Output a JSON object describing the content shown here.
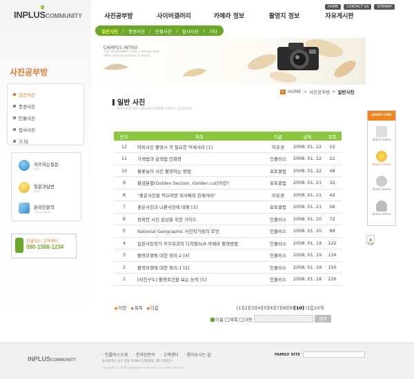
{
  "header": {
    "logo_main": "INPLUS",
    "logo_sub": "COMMUNITY",
    "top_links": [
      "HOME",
      "CONTACT US",
      "SITEMAP"
    ],
    "gnb": [
      "사진공부방",
      "사이버갤러리",
      "카메라 정보",
      "촬영지 정보",
      "자유게시판"
    ],
    "sub_menu": [
      "일반사진",
      "풍경사진",
      "인물사진",
      "접사사진",
      "기타"
    ]
  },
  "banner": {
    "title": "CAMPUS INTRO",
    "copy": "THE DESIGNING IS No.1 design web total solution partner in Korea"
  },
  "sidebar": {
    "title": "사진공부방",
    "menu": [
      "일반사진",
      "풍경사진",
      "인물사진",
      "접사사진",
      "기    타"
    ],
    "links": [
      {
        "label": "자주하는질문",
        "sub": "FAQ"
      },
      {
        "label": "질문과답변",
        "sub": "Q&A"
      },
      {
        "label": "온라인문의",
        "sub": "online guide"
      }
    ],
    "call_label": "인플러스 고객센터",
    "call_number": "080-1588-1234"
  },
  "content": {
    "title": "일반 사진",
    "description": "일반사진에 대한 이해/사용기/강좌를 가져하는 공간입니다.",
    "breadcrumb": [
      "HOME",
      "사진공부방",
      "일반사진"
    ]
  },
  "board": {
    "headers": [
      "번호",
      "제목",
      "이름",
      "날짜",
      "조회"
    ],
    "rows": [
      {
        "no": "12",
        "title": "야외사진 촬영시 꼭 필요한 악세사리 [1]",
        "name": "이유경",
        "date": "2008. 01. 22",
        "views": "15"
      },
      {
        "no": "11",
        "title": "가색법과 감색법 인화용",
        "name": "인플러스",
        "date": "2008. 01. 22",
        "views": "22"
      },
      {
        "no": "10",
        "title": "불꽃놀이 사진 촬영하는 방법",
        "name": "포토클럽",
        "date": "2008. 01. 22",
        "views": "48"
      },
      {
        "no": "9",
        "title": "황금분할(Golden Section, Golden cut)이란?",
        "name": "포토클럽",
        "date": "2008. 01. 21",
        "views": "32"
      },
      {
        "no": "8",
        "title": "\"좋은사진을 찍으려면 피사체와 친해져라\"",
        "name": "이유경",
        "date": "2008. 01. 21",
        "views": "42"
      },
      {
        "no": "7",
        "title": "좋은사진과 나쁜사진에 대해 [3]",
        "name": "포토클럽",
        "date": "2008. 01. 21",
        "views": "56"
      },
      {
        "no": "6",
        "title": "정확한 사진 감상을 위한 가이드",
        "name": "인플러스",
        "date": "2008. 01. 20",
        "views": "72"
      },
      {
        "no": "5",
        "title": "National Geographic 사진작가들의 조언",
        "name": "인플러스",
        "date": "2008. 01. 20",
        "views": "88"
      },
      {
        "no": "4",
        "title": "일본사진작가 후쿠쉬코의 디지털SLR 카메라 촬영방법",
        "name": "인플러스",
        "date": "2008. 01. 19",
        "views": "122"
      },
      {
        "no": "3",
        "title": "촬영모랫에 대한 정리-2 [4]",
        "name": "인플러스",
        "date": "2008. 01. 19",
        "views": "134"
      },
      {
        "no": "2",
        "title": "촬영모랫에 대한 정리-1 [2]",
        "name": "인플러스",
        "date": "2008. 01. 19",
        "views": "150"
      },
      {
        "no": "1",
        "title": "[사진구도] 촬영조건을 보는 능력 [5]",
        "name": "인플러스",
        "date": "2008. 01. 18",
        "views": "220"
      }
    ],
    "nav": [
      "이전",
      "목록",
      "다음"
    ],
    "pager_pre": "[1][2][3][4][5][6][7][8][9]",
    "pager_current": "[10]",
    "pager_post": " 다음10개",
    "search_opts": [
      "이름",
      "제목",
      "내용"
    ],
    "search_btn": "검색"
  },
  "quick": {
    "head": "QUICK LINK",
    "items": [
      "Quick menu",
      "Quick menu",
      "Quick menu",
      "Quick menu"
    ],
    "top": "TOP"
  },
  "footer": {
    "logo_main": "INPLUS",
    "logo_sub": "COMMUNITY",
    "links": [
      "인플러스소개",
      "온라인문의",
      "고객센터",
      "찾아오시는 길"
    ],
    "address": "울산광역시 남구 달동 1249-1 형림빌딩 3층 인플러스",
    "copyright": "copyright ⓒ 2004 designpara university. all rights reserved.",
    "family_site": "FAMILY SITE"
  },
  "colors": {
    "accent_green": "#6da72a",
    "accent_orange": "#e07a2b",
    "table_head": "#8cc63f"
  }
}
